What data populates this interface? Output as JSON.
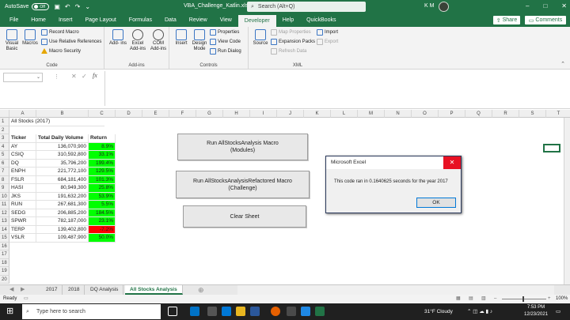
{
  "titlebar": {
    "autosave": "AutoSave",
    "toggle": "Off",
    "filename": "VBA_Challenge_Katlin.xlsm",
    "search": "Search (Alt+Q)",
    "user": "K M",
    "min": "–",
    "max": "□",
    "close": "✕"
  },
  "tabs": [
    "File",
    "Home",
    "Insert",
    "Page Layout",
    "Formulas",
    "Data",
    "Review",
    "View",
    "Developer",
    "Help",
    "QuickBooks"
  ],
  "share": "Share",
  "comments": "Comments",
  "ribbon": {
    "code": {
      "label": "Code",
      "vb": "Visual Basic",
      "macros": "Macros",
      "record": "Record Macro",
      "relative": "Use Relative References",
      "security": "Macro Security"
    },
    "addins": {
      "label": "Add-ins",
      "addins": "Add- ins",
      "excel": "Excel Add-ins",
      "com": "COM Add-ins"
    },
    "controls": {
      "label": "Controls",
      "insert": "Insert",
      "design": "Design Mode",
      "properties": "Properties",
      "viewcode": "View Code",
      "rundialog": "Run Dialog"
    },
    "xml": {
      "label": "XML",
      "source": "Source",
      "mapprops": "Map Properties",
      "expansion": "Expansion Packs",
      "refresh": "Refresh Data",
      "import": "Import",
      "export": "Export"
    }
  },
  "formula": {
    "namebox": "",
    "fx": "fx"
  },
  "columns": [
    "A",
    "B",
    "C",
    "D",
    "E",
    "F",
    "G",
    "H",
    "I",
    "J",
    "K",
    "L",
    "M",
    "N",
    "O",
    "P",
    "Q",
    "R",
    "S",
    "T"
  ],
  "rows": [
    "1",
    "2",
    "3",
    "4",
    "5",
    "6",
    "7",
    "8",
    "9",
    "10",
    "11",
    "12",
    "13",
    "14",
    "15",
    "16",
    "17",
    "18",
    "19",
    "20"
  ],
  "sheet": {
    "title": "All Stocks (2017)",
    "headers": [
      "Ticker",
      "Total Daily Volume",
      "Return"
    ],
    "data": [
      [
        "AY",
        "136,070,900",
        "8.9%",
        "green"
      ],
      [
        "CSIQ",
        "310,592,800",
        "33.1%",
        "green"
      ],
      [
        "DQ",
        "35,796,200",
        "199.4%",
        "green"
      ],
      [
        "ENPH",
        "221,772,100",
        "129.5%",
        "green"
      ],
      [
        "FSLR",
        "684,181,400",
        "101.3%",
        "green"
      ],
      [
        "HASI",
        "80,949,300",
        "25.8%",
        "green"
      ],
      [
        "JKS",
        "191,632,200",
        "53.9%",
        "green"
      ],
      [
        "RUN",
        "267,681,300",
        "5.5%",
        "green"
      ],
      [
        "SEDG",
        "206,885,200",
        "184.5%",
        "green"
      ],
      [
        "SPWR",
        "782,187,000",
        "23.1%",
        "green"
      ],
      [
        "TERP",
        "139,402,800",
        "-7.2%",
        "red"
      ],
      [
        "VSLR",
        "109,487,900",
        "50.0%",
        "green"
      ]
    ]
  },
  "buttons": {
    "run1a": "Run AllStocksAnalysis Macro",
    "run1b": "(Modules)",
    "run2a": "Run AllStocksAnalysisRefactored Macro",
    "run2b": "(Challenge)",
    "clear": "Clear Sheet"
  },
  "dialog": {
    "title": "Microsoft Excel",
    "message": "This code ran in 0.1640625 seconds for the year 2017",
    "ok": "OK",
    "close": "✕"
  },
  "sheettabs": [
    "2017",
    "2018",
    "DQ Analysis",
    "All Stocks Analysis"
  ],
  "status": {
    "ready": "Ready",
    "zoom": "100%"
  },
  "taskbar": {
    "search": "Type here to search",
    "weather": "31°F  Cloudy",
    "time": "7:53 PM",
    "date": "12/23/2021"
  },
  "colors": {
    "excel": "#217346",
    "positive": "#00ff00",
    "negative": "#ff0000"
  }
}
